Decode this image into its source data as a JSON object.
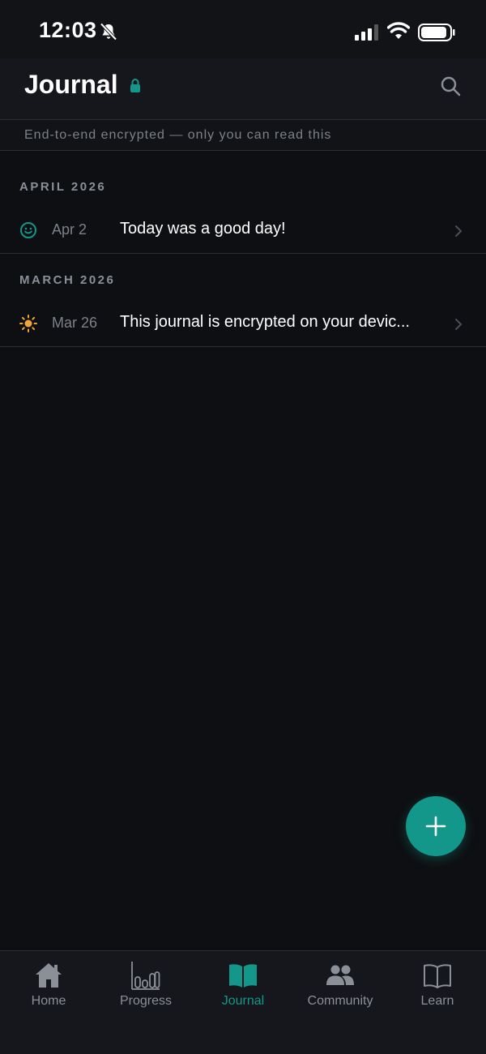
{
  "status_bar": {
    "time": "12:03"
  },
  "header": {
    "title": "Journal",
    "encryption_note": "End-to-end encrypted — only you can read this"
  },
  "sections": [
    {
      "heading": "APRIL 2026",
      "entries": [
        {
          "icon": "smiley-icon",
          "date": "Apr 2",
          "text": "Today was a good day!"
        }
      ]
    },
    {
      "heading": "MARCH 2026",
      "entries": [
        {
          "icon": "sun-icon",
          "date": "Mar 26",
          "text": "This journal is encrypted on your devic..."
        }
      ]
    }
  ],
  "tabs": [
    {
      "label": "Home",
      "icon": "home-icon"
    },
    {
      "label": "Progress",
      "icon": "bar-chart-icon"
    },
    {
      "label": "Journal",
      "icon": "book-icon",
      "active": true
    },
    {
      "label": "Community",
      "icon": "people-icon"
    },
    {
      "label": "Learn",
      "icon": "open-book-icon"
    }
  ],
  "colors": {
    "background": "#0e0f12",
    "accent": "#13978a",
    "muted_text": "#8a8f98",
    "sun": "#f0a43a"
  }
}
